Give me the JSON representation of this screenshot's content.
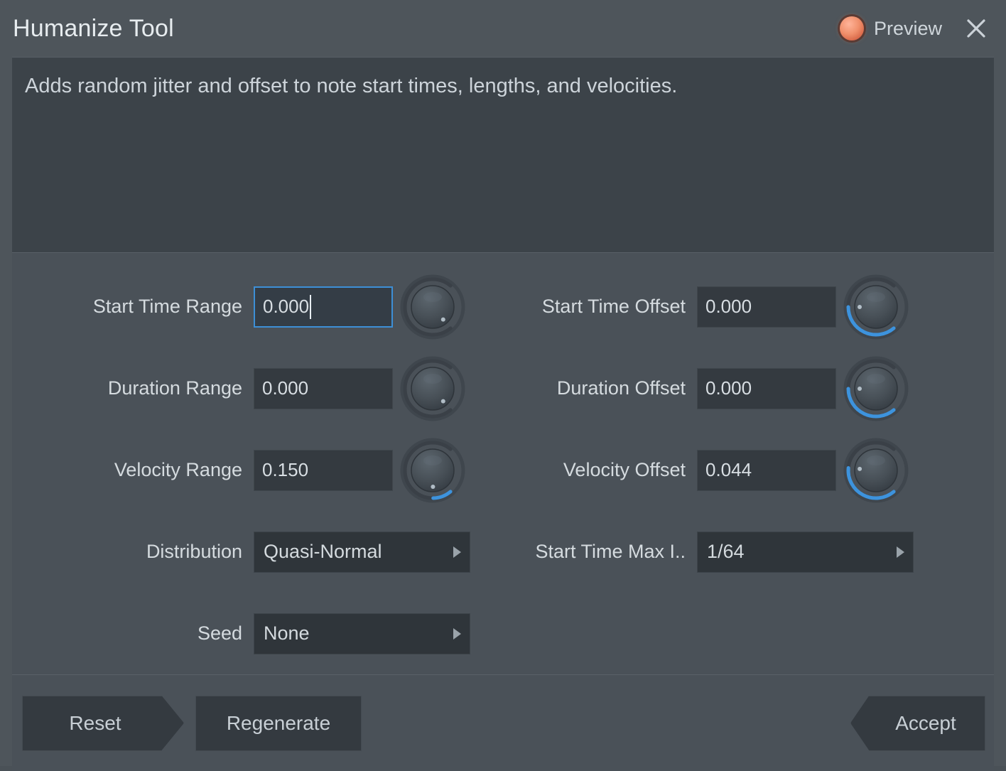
{
  "window": {
    "title": "Humanize Tool",
    "preview_label": "Preview",
    "preview_on": true,
    "close_icon": "close-icon"
  },
  "description": {
    "text": "Adds random jitter and offset to note start times, lengths, and velocities."
  },
  "controls": {
    "left": [
      {
        "label": "Start Time Range",
        "value": "0.000",
        "focused": true,
        "knob_arc": 0.0
      },
      {
        "label": "Duration Range",
        "value": "0.000",
        "focused": false,
        "knob_arc": 0.0
      },
      {
        "label": "Velocity Range",
        "value": "0.150",
        "focused": false,
        "knob_arc": 0.15
      }
    ],
    "right": [
      {
        "label": "Start Time Offset",
        "value": "0.000",
        "focused": false,
        "knob_arc": 0.5
      },
      {
        "label": "Duration Offset",
        "value": "0.000",
        "focused": false,
        "knob_arc": 0.5
      },
      {
        "label": "Velocity Offset",
        "value": "0.044",
        "focused": false,
        "knob_arc": 0.52
      }
    ]
  },
  "selects": {
    "distribution": {
      "label": "Distribution",
      "value": "Quasi-Normal"
    },
    "start_time_max": {
      "label": "Start Time Max I..",
      "value": "1/64"
    },
    "seed": {
      "label": "Seed",
      "value": "None"
    }
  },
  "footer": {
    "reset_label": "Reset",
    "regenerate_label": "Regenerate",
    "accept_label": "Accept"
  },
  "colors": {
    "accent_blue": "#3d93dd",
    "preview_led": "#f0906c",
    "dialog_bg": "#4e555b",
    "panel_bg": "#3c4349",
    "field_bg": "#343a40"
  }
}
